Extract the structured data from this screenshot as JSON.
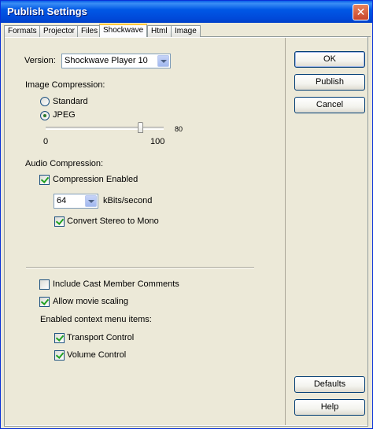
{
  "window": {
    "title": "Publish Settings",
    "close_glyph": "✕"
  },
  "tabs": [
    {
      "label": "Formats"
    },
    {
      "label": "Projector"
    },
    {
      "label": "Files"
    },
    {
      "label": "Shockwave",
      "active": true
    },
    {
      "label": "Html"
    },
    {
      "label": "Image"
    }
  ],
  "version": {
    "label": "Version:",
    "selected": "Shockwave Player 10"
  },
  "image_compression": {
    "heading": "Image Compression:",
    "standard_label": "Standard",
    "jpeg_label": "JPEG",
    "selected": "JPEG",
    "quality_value": "80",
    "quality_min": "0",
    "quality_max": "100"
  },
  "audio_compression": {
    "heading": "Audio Compression:",
    "enabled_label": "Compression Enabled",
    "enabled": true,
    "bitrate": "64",
    "bitrate_unit": "kBits/second",
    "stereo_to_mono_label": "Convert Stereo to Mono",
    "stereo_to_mono": true
  },
  "options": {
    "cast_comments_label": "Include Cast Member Comments",
    "cast_comments": false,
    "movie_scaling_label": "Allow movie scaling",
    "movie_scaling": true,
    "context_menu_heading": "Enabled context menu items:",
    "transport_label": "Transport Control",
    "transport": true,
    "volume_label": "Volume Control",
    "volume": true
  },
  "buttons": {
    "ok": "OK",
    "publish": "Publish",
    "cancel": "Cancel",
    "defaults": "Defaults",
    "help": "Help"
  },
  "colors": {
    "titlebar": "#0058e6",
    "face": "#ece9d8",
    "active_tab_accent": "#ffc83c",
    "check_mark": "#21a121"
  }
}
